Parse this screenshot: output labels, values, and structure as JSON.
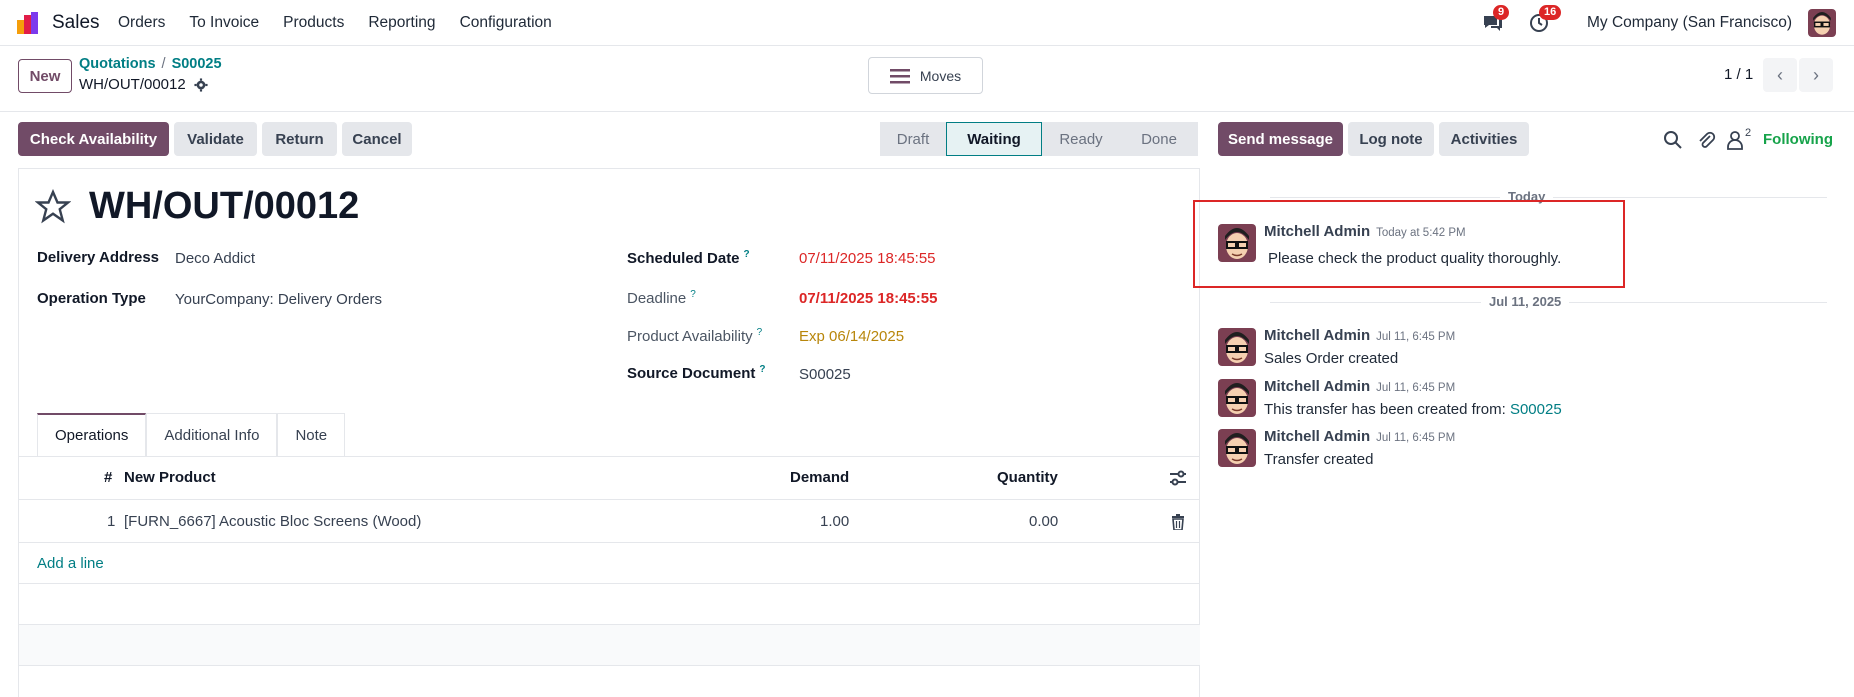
{
  "navbar": {
    "app_name": "Sales",
    "menu": [
      "Orders",
      "To Invoice",
      "Products",
      "Reporting",
      "Configuration"
    ],
    "messages_badge": "9",
    "activities_badge": "16",
    "company": "My Company (San Francisco)"
  },
  "control": {
    "new_label": "New",
    "breadcrumb": [
      "Quotations",
      "S00025"
    ],
    "breadcrumb_sep": "/",
    "current": "WH/OUT/00012",
    "moves_label": "Moves",
    "pager": "1 / 1"
  },
  "toolbar": {
    "check_availability": "Check Availability",
    "validate": "Validate",
    "return": "Return",
    "cancel": "Cancel"
  },
  "status": {
    "stages": [
      "Draft",
      "Waiting",
      "Ready",
      "Done"
    ],
    "active": "Waiting"
  },
  "form": {
    "title": "WH/OUT/00012",
    "delivery_address_label": "Delivery Address",
    "delivery_address": "Deco Addict",
    "operation_type_label": "Operation Type",
    "operation_type": "YourCompany: Delivery Orders",
    "scheduled_date_label": "Scheduled Date",
    "scheduled_date": "07/11/2025 18:45:55",
    "deadline_label": "Deadline",
    "deadline": "07/11/2025 18:45:55",
    "availability_label": "Product Availability",
    "availability": "Exp 06/14/2025",
    "source_label": "Source Document",
    "source": "S00025",
    "help_mark": "?",
    "tabs": [
      "Operations",
      "Additional Info",
      "Note"
    ],
    "table": {
      "headers": [
        "#",
        "New Product",
        "Demand",
        "Quantity"
      ],
      "rows": [
        {
          "num": "1",
          "product": "[FURN_6667] Acoustic Bloc Screens (Wood)",
          "demand": "1.00",
          "quantity": "0.00"
        }
      ],
      "add_line": "Add a line"
    }
  },
  "chatter": {
    "send_message": "Send message",
    "log_note": "Log note",
    "activities": "Activities",
    "followers_count": "2",
    "following": "Following",
    "date_today": "Today",
    "date_jul": "Jul 11, 2025",
    "messages": [
      {
        "author": "Mitchell Admin",
        "time": "Today at 5:42 PM",
        "body": "Please check the product quality thoroughly."
      },
      {
        "author": "Mitchell Admin",
        "time": "Jul 11, 6:45 PM",
        "body": "Sales Order created"
      },
      {
        "author": "Mitchell Admin",
        "time": "Jul 11, 6:45 PM",
        "body": "This transfer has been created from:",
        "link": "S00025"
      },
      {
        "author": "Mitchell Admin",
        "time": "Jul 11, 6:45 PM",
        "body": "Transfer created"
      }
    ]
  },
  "colors": {
    "brand": "#714b67",
    "accent": "#017e84",
    "danger": "#dc2626",
    "success": "#16a34a"
  }
}
